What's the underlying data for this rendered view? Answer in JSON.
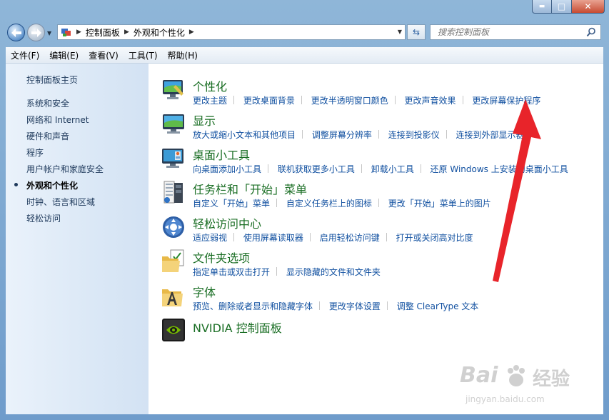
{
  "window": {
    "caption_min": "▬",
    "caption_max": "□",
    "caption_close": "✕"
  },
  "address": {
    "crumbs": [
      "控制面板",
      "外观和个性化"
    ]
  },
  "search": {
    "placeholder": "搜索控制面板",
    "icon": "search-icon"
  },
  "menu": [
    "文件(F)",
    "编辑(E)",
    "查看(V)",
    "工具(T)",
    "帮助(H)"
  ],
  "sidebar": {
    "items": [
      {
        "label": "控制面板主页",
        "current": false
      },
      {
        "label": "系统和安全",
        "current": false
      },
      {
        "label": "网络和 Internet",
        "current": false
      },
      {
        "label": "硬件和声音",
        "current": false
      },
      {
        "label": "程序",
        "current": false
      },
      {
        "label": "用户帐户和家庭安全",
        "current": false
      },
      {
        "label": "外观和个性化",
        "current": true
      },
      {
        "label": "时钟、语言和区域",
        "current": false
      },
      {
        "label": "轻松访问",
        "current": false
      }
    ]
  },
  "categories": [
    {
      "title": "个性化",
      "icon": "personalization-icon",
      "links": [
        "更改主题",
        "更改桌面背景",
        "更改半透明窗口颜色",
        "更改声音效果",
        "更改屏幕保护程序"
      ]
    },
    {
      "title": "显示",
      "icon": "display-icon",
      "links": [
        "放大或缩小文本和其他项目",
        "调整屏幕分辨率",
        "连接到投影仪",
        "连接到外部显示器"
      ]
    },
    {
      "title": "桌面小工具",
      "icon": "gadgets-icon",
      "links": [
        "向桌面添加小工具",
        "联机获取更多小工具",
        "卸载小工具",
        "还原 Windows 上安装的桌面小工具"
      ]
    },
    {
      "title": "任务栏和「开始」菜单",
      "icon": "taskbar-icon",
      "links": [
        "自定义「开始」菜单",
        "自定义任务栏上的图标",
        "更改「开始」菜单上的图片"
      ]
    },
    {
      "title": "轻松访问中心",
      "icon": "ease-of-access-icon",
      "links": [
        "适应弱视",
        "使用屏幕读取器",
        "启用轻松访问键",
        "打开或关闭高对比度"
      ]
    },
    {
      "title": "文件夹选项",
      "icon": "folder-options-icon",
      "links": [
        "指定单击或双击打开",
        "显示隐藏的文件和文件夹"
      ]
    },
    {
      "title": "字体",
      "icon": "fonts-icon",
      "links": [
        "预览、删除或者显示和隐藏字体",
        "更改字体设置",
        "调整 ClearType 文本"
      ]
    },
    {
      "title": "NVIDIA 控制面板",
      "icon": "nvidia-icon",
      "links": []
    }
  ],
  "colors": {
    "category_title": "#1a6e24",
    "link": "#1150a0",
    "sidebar_text": "#1e395b",
    "annotation_arrow": "#e8242a"
  },
  "watermark": {
    "brand": "Bai",
    "brand_cn": "经验",
    "url": "jingyan.baidu.com"
  }
}
